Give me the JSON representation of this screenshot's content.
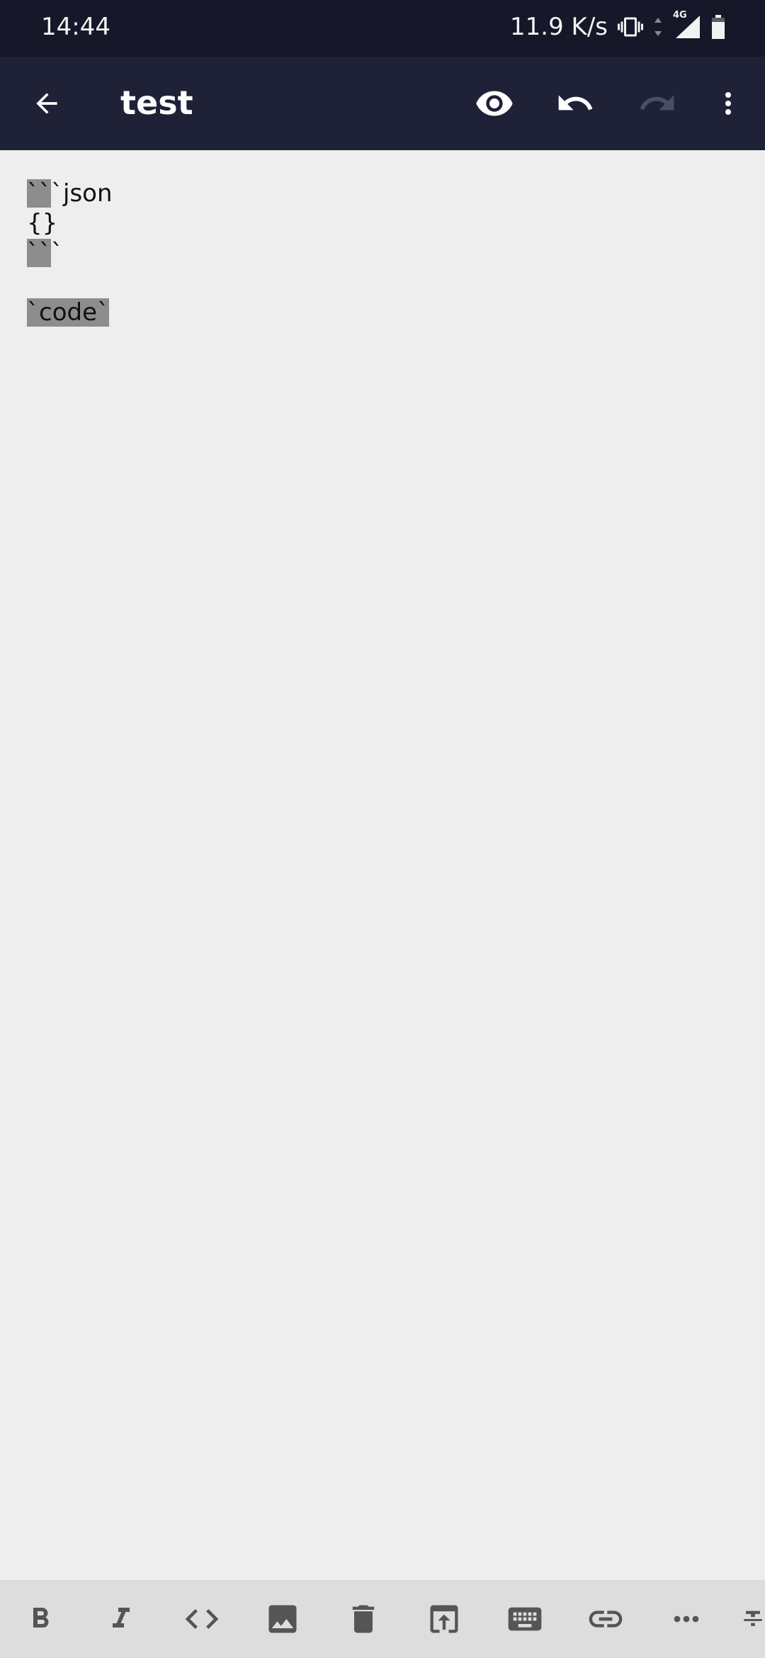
{
  "status_bar": {
    "time": "14:44",
    "network_speed": "11.9 K/s",
    "network_type": "4G",
    "icons": [
      "vibrate-icon",
      "data-arrows-icon",
      "signal-icon",
      "battery-icon"
    ]
  },
  "app_bar": {
    "title": "test",
    "actions": [
      "back-arrow-icon",
      "eye-icon",
      "undo-icon",
      "redo-icon",
      "more-vert-icon"
    ],
    "redo_enabled": false
  },
  "editor": {
    "lines": [
      {
        "highlight": "``",
        "rest": "`json"
      },
      {
        "highlight": "",
        "rest": "{}"
      },
      {
        "highlight": "``",
        "rest": "`"
      },
      {
        "highlight": "`code`",
        "rest": ""
      }
    ]
  },
  "toolbar": {
    "items": [
      "bold-icon",
      "italic-icon",
      "code-icon",
      "image-icon",
      "delete-icon",
      "open-in-icon",
      "keyboard-icon",
      "link-icon",
      "more-horiz-icon",
      "strikethrough-icon"
    ]
  },
  "colors": {
    "status_bar": "#161829",
    "app_bar": "#1f2137",
    "editor_bg": "#eeeeee",
    "highlight": "#8d8d8d",
    "toolbar_bg": "#dddddd",
    "toolbar_icon": "#555555"
  }
}
